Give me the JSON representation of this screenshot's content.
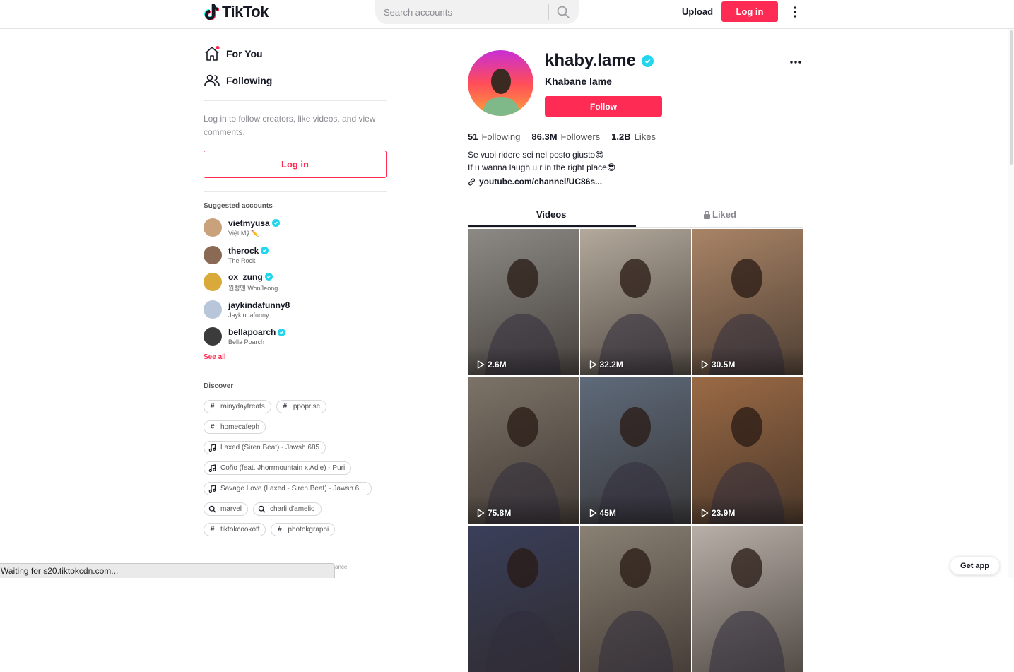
{
  "header": {
    "logo_text": "TikTok",
    "search_placeholder": "Search accounts",
    "upload_label": "Upload",
    "login_label": "Log in"
  },
  "sidebar": {
    "nav": [
      {
        "label": "For You",
        "icon": "home-icon"
      },
      {
        "label": "Following",
        "icon": "people-icon"
      }
    ],
    "login_hint": "Log in to follow creators, like videos, and view comments.",
    "login_button": "Log in",
    "suggested_title": "Suggested accounts",
    "suggested": [
      {
        "username": "vietmyusa",
        "nickname": "Việt Mỹ ✏️",
        "verified": true,
        "color": "#c9a27c"
      },
      {
        "username": "therock",
        "nickname": "The Rock",
        "verified": true,
        "color": "#8a6a54"
      },
      {
        "username": "ox_zung",
        "nickname": "원정맨 WonJeong",
        "verified": true,
        "color": "#d9a93a"
      },
      {
        "username": "jaykindafunny8",
        "nickname": "Jaykindafunny",
        "verified": false,
        "color": "#b7c6d8"
      },
      {
        "username": "bellapoarch",
        "nickname": "Bella Poarch",
        "verified": true,
        "color": "#3b3b3b"
      }
    ],
    "see_all": "See all",
    "discover_title": "Discover",
    "discover": [
      {
        "type": "hashtag",
        "icon": "hashtag-icon",
        "label": "rainydaytreats"
      },
      {
        "type": "hashtag",
        "icon": "hashtag-icon",
        "label": "ppoprise"
      },
      {
        "type": "hashtag",
        "icon": "hashtag-icon",
        "label": "homecafeph"
      },
      {
        "type": "music",
        "icon": "music-note-icon",
        "label": "Laxed (Siren Beat) - Jawsh 685"
      },
      {
        "type": "music",
        "icon": "music-note-icon",
        "label": "Coño (feat. Jhorrmountain x Adje) - Puri"
      },
      {
        "type": "music",
        "icon": "music-note-icon",
        "label": "Savage Love (Laxed - Siren Beat) - Jawsh 6..."
      },
      {
        "type": "search",
        "icon": "search-icon",
        "label": "marvel"
      },
      {
        "type": "search",
        "icon": "search-icon",
        "label": "charli d'amelio"
      },
      {
        "type": "hashtag",
        "icon": "hashtag-icon",
        "label": "tiktokcookoff"
      },
      {
        "type": "hashtag",
        "icon": "hashtag-icon",
        "label": "photokgraphi"
      }
    ]
  },
  "profile": {
    "username": "khaby.lame",
    "name": "Khabane lame",
    "verified": true,
    "follow_label": "Follow",
    "stats": [
      {
        "value": "51",
        "label": "Following"
      },
      {
        "value": "86.3M",
        "label": "Followers"
      },
      {
        "value": "1.2B",
        "label": "Likes"
      }
    ],
    "bio_lines": [
      "Se vuoi ridere sei nel posto giusto😎",
      "If u wanna laugh u r in the right place😎"
    ],
    "link": "youtube.com/channel/UC86s..."
  },
  "tabs": {
    "videos": "Videos",
    "liked": "Liked"
  },
  "videos": [
    {
      "views": "2.6M",
      "bg": "#8d8a86"
    },
    {
      "views": "32.2M",
      "bg": "#b3a99c"
    },
    {
      "views": "30.5M",
      "bg": "#a98466"
    },
    {
      "views": "75.8M",
      "bg": "#7c7368"
    },
    {
      "views": "45M",
      "bg": "#5e6a7a"
    },
    {
      "views": "23.9M",
      "bg": "#9b6a45"
    },
    {
      "views": "",
      "bg": "#3a3f5a"
    },
    {
      "views": "",
      "bg": "#8a8174"
    },
    {
      "views": "",
      "bg": "#b8b0a8"
    }
  ],
  "status_bar": "Waiting for s20.tiktokcdn.com...",
  "status_tail": "ance",
  "get_app": "Get app",
  "colors": {
    "brand": "#fe2c55",
    "verified": "#20d5ec",
    "text": "#161823",
    "muted": "#8a8b91"
  }
}
